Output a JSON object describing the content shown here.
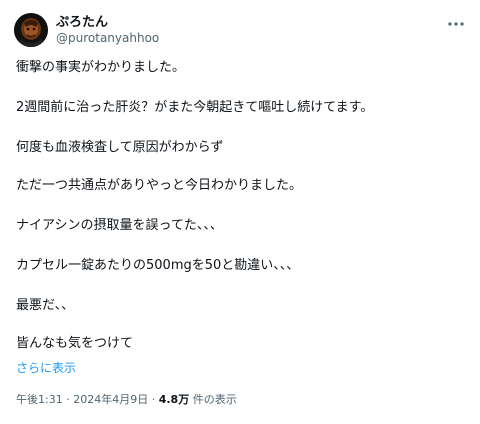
{
  "author": {
    "display_name": "ぷろたん",
    "handle": "@purotanyahhoo"
  },
  "tweet": {
    "lines": [
      "衝撃の事実がわかりました。",
      "2週間前に治った肝炎？がまた今朝起きて嘔吐し続けてます。",
      "何度も血液検査して原因がわからず",
      "ただ一つ共通点がありやっと今日わかりました。",
      "ナイアシンの摂取量を誤ってた、、、",
      "カプセル一錠あたりの500mgを50と勘違い、、、",
      "最悪だ、、",
      "皆んなも気をつけて"
    ],
    "show_more_label": "さらに表示"
  },
  "meta": {
    "time": "午後1:31",
    "separator": "·",
    "date": "2024年4月9日",
    "views_count": "4.8万",
    "views_label": "件の表示"
  },
  "icons": {
    "more": "more-horizontal-icon"
  },
  "colors": {
    "text": "#0f1419",
    "secondary": "#536471",
    "link": "#1d9bf0"
  }
}
